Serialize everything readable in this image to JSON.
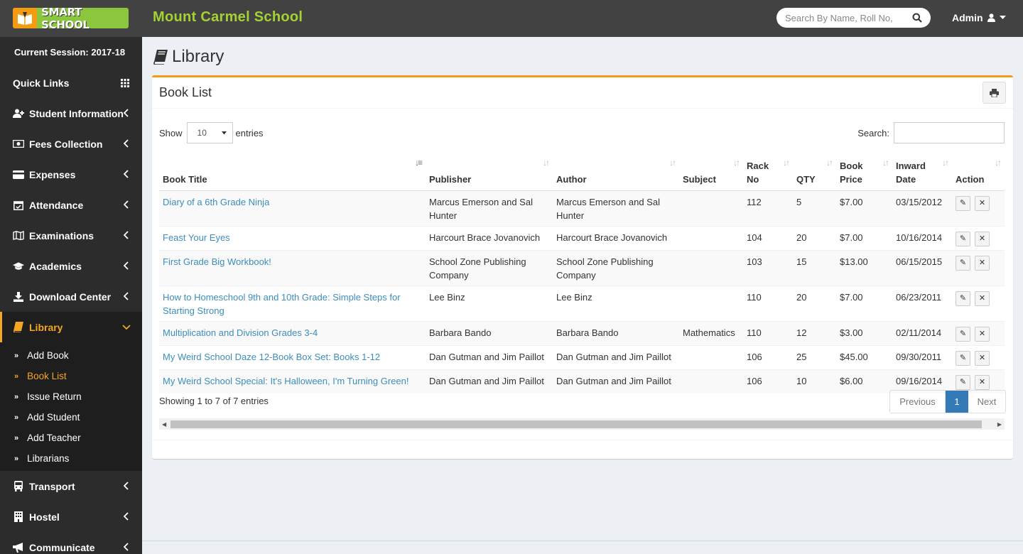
{
  "header": {
    "logo_text": "SMART SCHOOL",
    "school_name": "Mount Carmel School",
    "search_placeholder": "Search By Name, Roll No,",
    "user": "Admin"
  },
  "sidebar": {
    "session": "Current Session: 2017-18",
    "quick_links": "Quick Links",
    "items_top": [
      {
        "label": "Student Information",
        "icon": "user-plus-icon"
      },
      {
        "label": "Fees Collection",
        "icon": "money-icon"
      },
      {
        "label": "Expenses",
        "icon": "credit-card-icon"
      },
      {
        "label": "Attendance",
        "icon": "calendar-check-icon"
      },
      {
        "label": "Examinations",
        "icon": "map-icon"
      },
      {
        "label": "Academics",
        "icon": "graduation-cap-icon"
      },
      {
        "label": "Download Center",
        "icon": "download-icon"
      }
    ],
    "library": "Library",
    "library_sub": [
      "Add Book",
      "Book List",
      "Issue Return",
      "Add Student",
      "Add Teacher",
      "Librarians"
    ],
    "items_bottom": [
      {
        "label": "Transport",
        "icon": "bus-icon"
      },
      {
        "label": "Hostel",
        "icon": "building-icon"
      },
      {
        "label": "Communicate",
        "icon": "bullhorn-icon"
      }
    ]
  },
  "page": {
    "title": "Library",
    "box_title": "Book List",
    "show_label": "Show",
    "entries_value": "10",
    "entries_label": "entries",
    "search_label": "Search:"
  },
  "table": {
    "columns": [
      "Book Title",
      "Publisher",
      "Author",
      "Subject",
      "Rack No",
      "QTY",
      "Book Price",
      "Inward Date",
      "Action"
    ],
    "rows": [
      {
        "title": "Diary of a 6th Grade Ninja",
        "publisher": "Marcus Emerson and Sal Hunter",
        "author": "Marcus Emerson and Sal Hunter",
        "subject": "",
        "rack": "112",
        "qty": "5",
        "price": "$7.00",
        "date": "03/15/2012"
      },
      {
        "title": "Feast Your Eyes",
        "publisher": "Harcourt Brace Jovanovich",
        "author": "Harcourt Brace Jovanovich",
        "subject": "",
        "rack": "104",
        "qty": "20",
        "price": "$7.00",
        "date": "10/16/2014"
      },
      {
        "title": "First Grade Big Workbook!",
        "publisher": "School Zone Publishing Company",
        "author": "School Zone Publishing Company",
        "subject": "",
        "rack": "103",
        "qty": "15",
        "price": "$13.00",
        "date": "06/15/2015"
      },
      {
        "title": "How to Homeschool 9th and 10th Grade: Simple Steps for Starting Strong",
        "publisher": "Lee Binz",
        "author": "Lee Binz",
        "subject": "",
        "rack": "110",
        "qty": "20",
        "price": "$7.00",
        "date": "06/23/2011"
      },
      {
        "title": "Multiplication and Division Grades 3-4",
        "publisher": "Barbara Bando",
        "author": "Barbara Bando",
        "subject": "Mathematics",
        "rack": "110",
        "qty": "12",
        "price": "$3.00",
        "date": "02/11/2014"
      },
      {
        "title": "My Weird School Daze 12-Book Box Set: Books 1-12",
        "publisher": "Dan Gutman and Jim Paillot",
        "author": "Dan Gutman and Jim Paillot",
        "subject": "",
        "rack": "106",
        "qty": "25",
        "price": "$45.00",
        "date": "09/30/2011"
      },
      {
        "title": "My Weird School Special: It's Halloween, I'm Turning Green!",
        "publisher": "Dan Gutman and Jim Paillot",
        "author": "Dan Gutman and Jim Paillot",
        "subject": "",
        "rack": "106",
        "qty": "10",
        "price": "$6.00",
        "date": "09/16/2014"
      }
    ]
  },
  "footer": {
    "info": "Showing 1 to 7 of 7 entries",
    "prev": "Previous",
    "page": "1",
    "next": "Next"
  }
}
